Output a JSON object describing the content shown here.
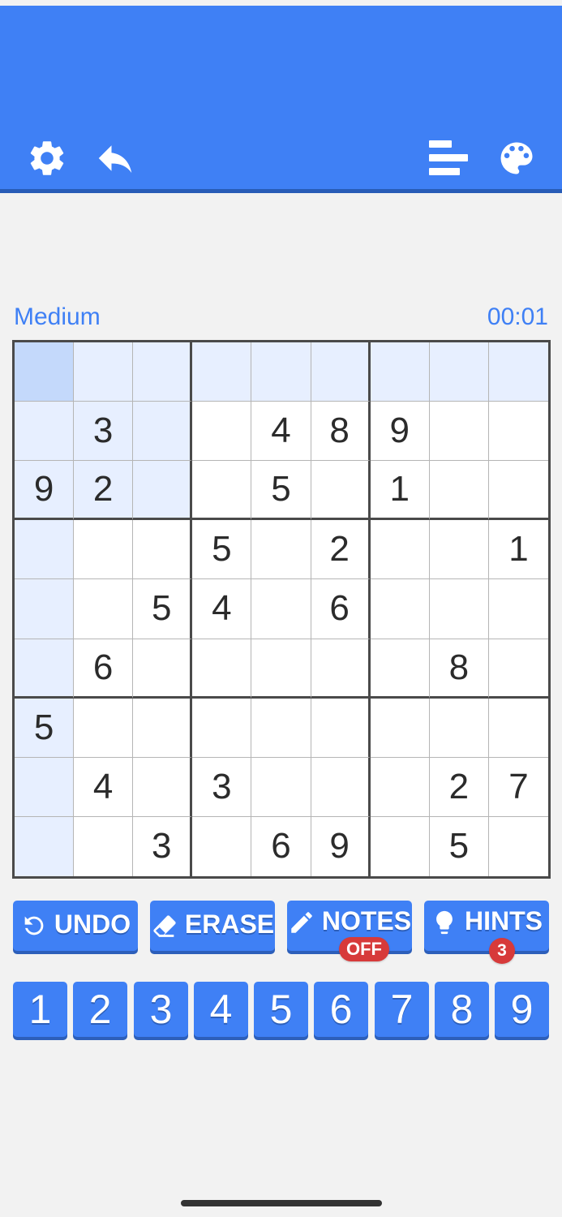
{
  "header": {
    "icons": [
      "gear-icon",
      "reply-arrow-icon",
      "stats-bars-icon",
      "palette-icon"
    ]
  },
  "game": {
    "difficulty": "Medium",
    "timer": "00:01"
  },
  "board": {
    "selected": [
      0,
      0
    ],
    "grid": [
      [
        "",
        "",
        "",
        "",
        "",
        "",
        "",
        "",
        ""
      ],
      [
        "",
        "3",
        "",
        "",
        "4",
        "8",
        "9",
        "",
        ""
      ],
      [
        "9",
        "2",
        "",
        "",
        "5",
        "",
        "1",
        "",
        ""
      ],
      [
        "",
        "",
        "",
        "5",
        "",
        "2",
        "",
        "",
        "1"
      ],
      [
        "",
        "",
        "5",
        "4",
        "",
        "6",
        "",
        "",
        ""
      ],
      [
        "",
        "6",
        "",
        "",
        "",
        "",
        "",
        "8",
        ""
      ],
      [
        "5",
        "",
        "",
        "",
        "",
        "",
        "",
        "",
        ""
      ],
      [
        "",
        "4",
        "",
        "3",
        "",
        "",
        "",
        "2",
        "7"
      ],
      [
        "",
        "",
        "3",
        "",
        "6",
        "9",
        "",
        "5",
        ""
      ]
    ]
  },
  "tools": {
    "undo": "UNDO",
    "erase": "ERASE",
    "notes": "NOTES",
    "notes_state": "OFF",
    "hints": "HINTS",
    "hints_count": "3"
  },
  "numpad": [
    "1",
    "2",
    "3",
    "4",
    "5",
    "6",
    "7",
    "8",
    "9"
  ],
  "colors": {
    "primary": "#3f80f5",
    "highlight": "#e7efff",
    "selected": "#c4d9fb",
    "badge": "#d73a3a"
  }
}
